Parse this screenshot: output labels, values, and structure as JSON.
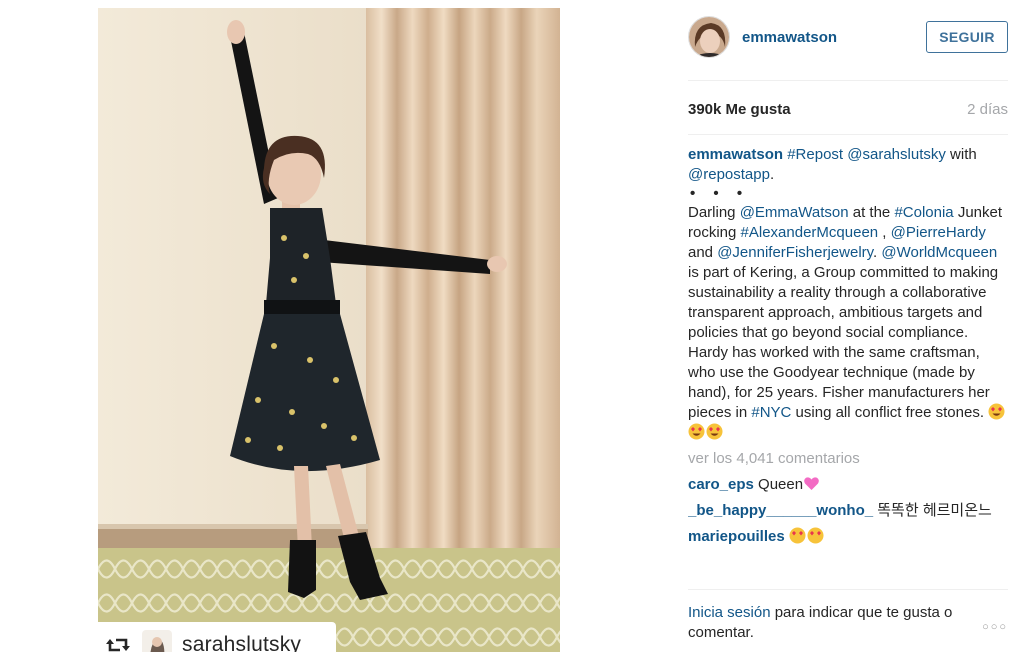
{
  "post": {
    "repost_user": "sarahslutsky"
  },
  "header": {
    "username": "emmawatson",
    "follow_label": "SEGUIR"
  },
  "stats": {
    "likes": "390k Me gusta",
    "time": "2 días"
  },
  "caption": {
    "username": "emmawatson",
    "repost_tag": "#Repost",
    "mention_author": "@sarahslutsky",
    "with_text": " with",
    "repostapp": "@repostapp",
    "dots": "• • •",
    "t1": "Darling ",
    "m_emma": "@EmmaWatson",
    "t2": " at the ",
    "h_colonia": "#Colonia",
    "t3": " Junket rocking ",
    "h_mcqueen": "#AlexanderMcqueen",
    "t4": " ,",
    "m_pierre": "@PierreHardy",
    "t5": " and ",
    "m_jennifer": "@JenniferFisherjewelry",
    "t6": ".",
    "m_world": "@WorldMcqueen",
    "t7": " is part of Kering, a Group committed to making sustainability a reality through a collaborative transparent approach, ambitious targets and policies that go beyond social compliance. Hardy has worked with the same craftsman, who use the Goodyear technique (made by hand), for 25 years. Fisher manufacturers her pieces in ",
    "h_nyc": "#NYC",
    "t8": " using all conflict free stones. "
  },
  "comments": {
    "view_all": "ver los 4,041 comentarios",
    "items": [
      {
        "user": "caro_eps",
        "text": "Queen"
      },
      {
        "user": "_be_happy______wonho_",
        "text": " 똑똑한 헤르미온느"
      },
      {
        "user": "mariepouilles",
        "text": ""
      }
    ]
  },
  "footer": {
    "login": "Inicia sesión",
    "rest": " para indicar que te gusta o comentar.",
    "more": "○○○"
  },
  "colors": {
    "link": "#125688",
    "follow": "#3f729b",
    "muted": "#a5a7aa"
  }
}
